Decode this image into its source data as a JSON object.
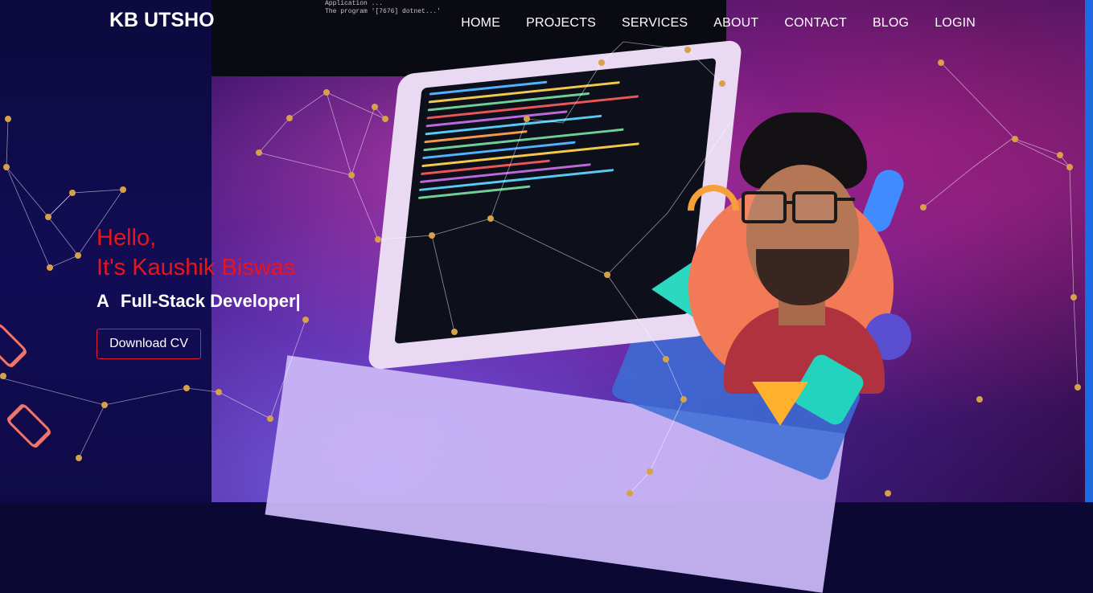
{
  "brand": {
    "name": "KB UTSHO"
  },
  "nav": {
    "items": [
      {
        "label": "HOME"
      },
      {
        "label": "PROJECTS"
      },
      {
        "label": "SERVICES"
      },
      {
        "label": "ABOUT"
      },
      {
        "label": "CONTACT"
      },
      {
        "label": "BLOG"
      },
      {
        "label": "LOGIN"
      }
    ]
  },
  "hero": {
    "greeting": "Hello,",
    "intro": "It's Kaushik Biswas",
    "role_prefix": "A",
    "role": "Full-Stack Developer|",
    "cv_button": "Download CV"
  },
  "background": {
    "monitor_text": "Application ...\nThe program '[7676] dotnet...'"
  },
  "colors": {
    "accent_red": "#e9151c",
    "panel_navy": "#0c0a3e",
    "button_border": "#e21c33",
    "star_gold": "#d7a14a"
  }
}
